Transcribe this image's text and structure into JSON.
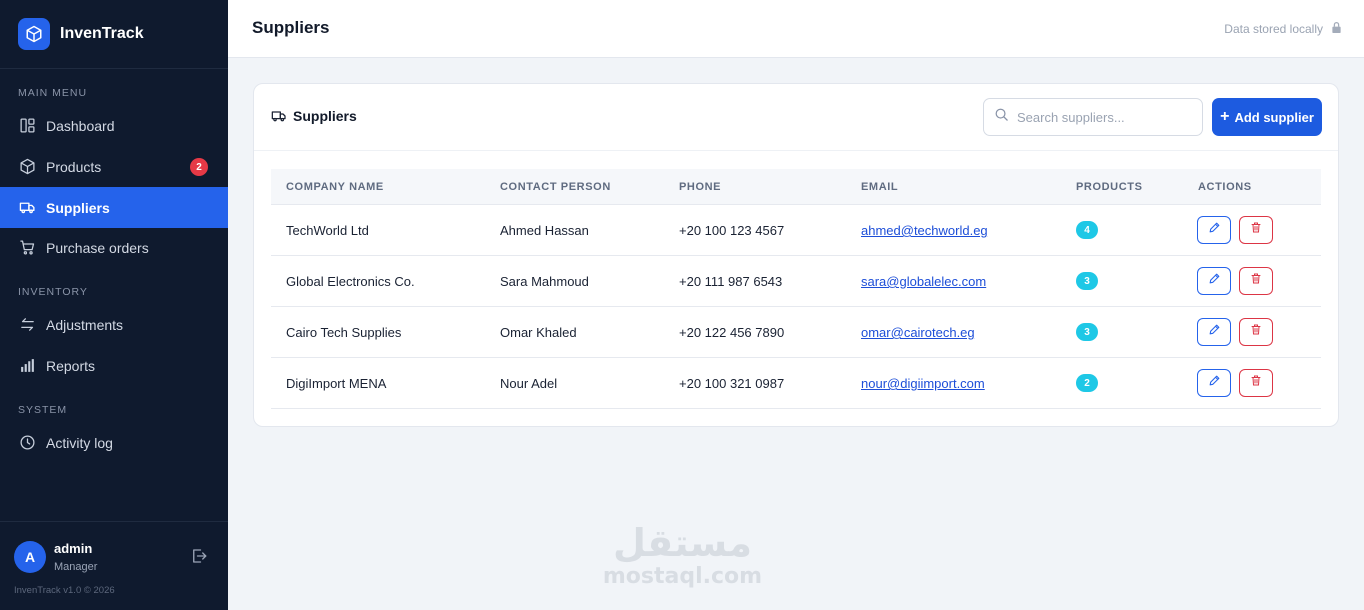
{
  "app": {
    "name": "InvenTrack",
    "icon": "box-icon",
    "accent": "#2563eb"
  },
  "sidebar": {
    "sections": {
      "main": "MAIN MENU",
      "inventory": "INVENTORY",
      "system": "SYSTEM"
    },
    "items": [
      {
        "label": "Dashboard",
        "icon": "dashboard-icon"
      },
      {
        "label": "Products",
        "icon": "box-icon",
        "badge": "2"
      },
      {
        "label": "Suppliers",
        "icon": "truck-icon",
        "active": true
      },
      {
        "label": "Purchase orders",
        "icon": "cart-icon"
      },
      {
        "label": "Adjustments",
        "icon": "arrows-icon"
      },
      {
        "label": "Reports",
        "icon": "bar-chart-icon"
      },
      {
        "label": "Activity log",
        "icon": "clock-icon"
      }
    ],
    "user": {
      "initial": "A",
      "name": "admin",
      "role": "Manager"
    },
    "version": "InvenTrack v1.0 © 2026"
  },
  "topbar": {
    "title": "Suppliers",
    "storage_note": "Data stored locally"
  },
  "card": {
    "title": "Suppliers",
    "search_placeholder": "Search suppliers...",
    "add_label": "Add supplier"
  },
  "table": {
    "headers": [
      "COMPANY NAME",
      "CONTACT PERSON",
      "PHONE",
      "EMAIL",
      "PRODUCTS",
      "ACTIONS"
    ],
    "rows": [
      {
        "company": "TechWorld Ltd",
        "contact": "Ahmed Hassan",
        "phone": "+20 100 123 4567",
        "email": "ahmed@techworld.eg",
        "products": "4"
      },
      {
        "company": "Global Electronics Co.",
        "contact": "Sara Mahmoud",
        "phone": "+20 111 987 6543",
        "email": "sara@globalelec.com",
        "products": "3"
      },
      {
        "company": "Cairo Tech Supplies",
        "contact": "Omar Khaled",
        "phone": "+20 122 456 7890",
        "email": "omar@cairotech.eg",
        "products": "3"
      },
      {
        "company": "DigiImport MENA",
        "contact": "Nour Adel",
        "phone": "+20 100 321 0987",
        "email": "nour@digiimport.com",
        "products": "2"
      }
    ]
  },
  "watermark": {
    "arabic": "مستقل",
    "latin": "mostaql.com"
  }
}
